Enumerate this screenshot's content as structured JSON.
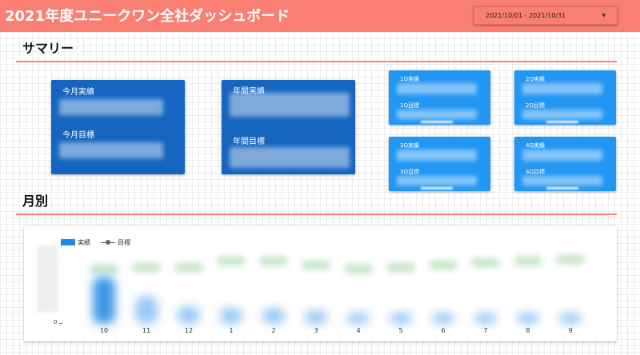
{
  "header": {
    "title": "2021年度ユニークワン全社ダッシュボード",
    "date_range": "2021/10/01 - 2021/10/31",
    "dropdown_icon": "caret-down-icon"
  },
  "colors": {
    "header": "#f87f72",
    "card_dark": "#1565c0",
    "card_light": "#2196f3",
    "actual": "#1e88e5",
    "target": "#4caf50"
  },
  "summary": {
    "title": "サマリー",
    "monthly_actual_label": "今月実績",
    "monthly_target_label": "今月目標",
    "annual_actual_label": "年間実績",
    "annual_target_label": "年間目標",
    "quarters": [
      {
        "actual_label": "1Q実績",
        "target_label": "1Q目標"
      },
      {
        "actual_label": "2Q実績",
        "target_label": "2Q目標"
      },
      {
        "actual_label": "3Q実績",
        "target_label": "3Q目標"
      },
      {
        "actual_label": "4Q実績",
        "target_label": "4Q目標"
      }
    ]
  },
  "monthly": {
    "title": "月別",
    "legend_actual": "実績",
    "legend_target": "目標",
    "y_zero": "0",
    "legend_line_icon": "line-marker-icon"
  },
  "chart_data": {
    "type": "bar",
    "categories": [
      "10",
      "11",
      "12",
      "1",
      "2",
      "3",
      "4",
      "5",
      "6",
      "7",
      "8",
      "9"
    ],
    "series": [
      {
        "name": "実績",
        "values": [
          60,
          35,
          22,
          20,
          20,
          17,
          14,
          14,
          14,
          14,
          14,
          14
        ]
      },
      {
        "name": "目標",
        "values": [
          70,
          72,
          72,
          80,
          80,
          75,
          70,
          72,
          75,
          78,
          80,
          82
        ]
      }
    ],
    "ylim": [
      0,
      100
    ]
  }
}
